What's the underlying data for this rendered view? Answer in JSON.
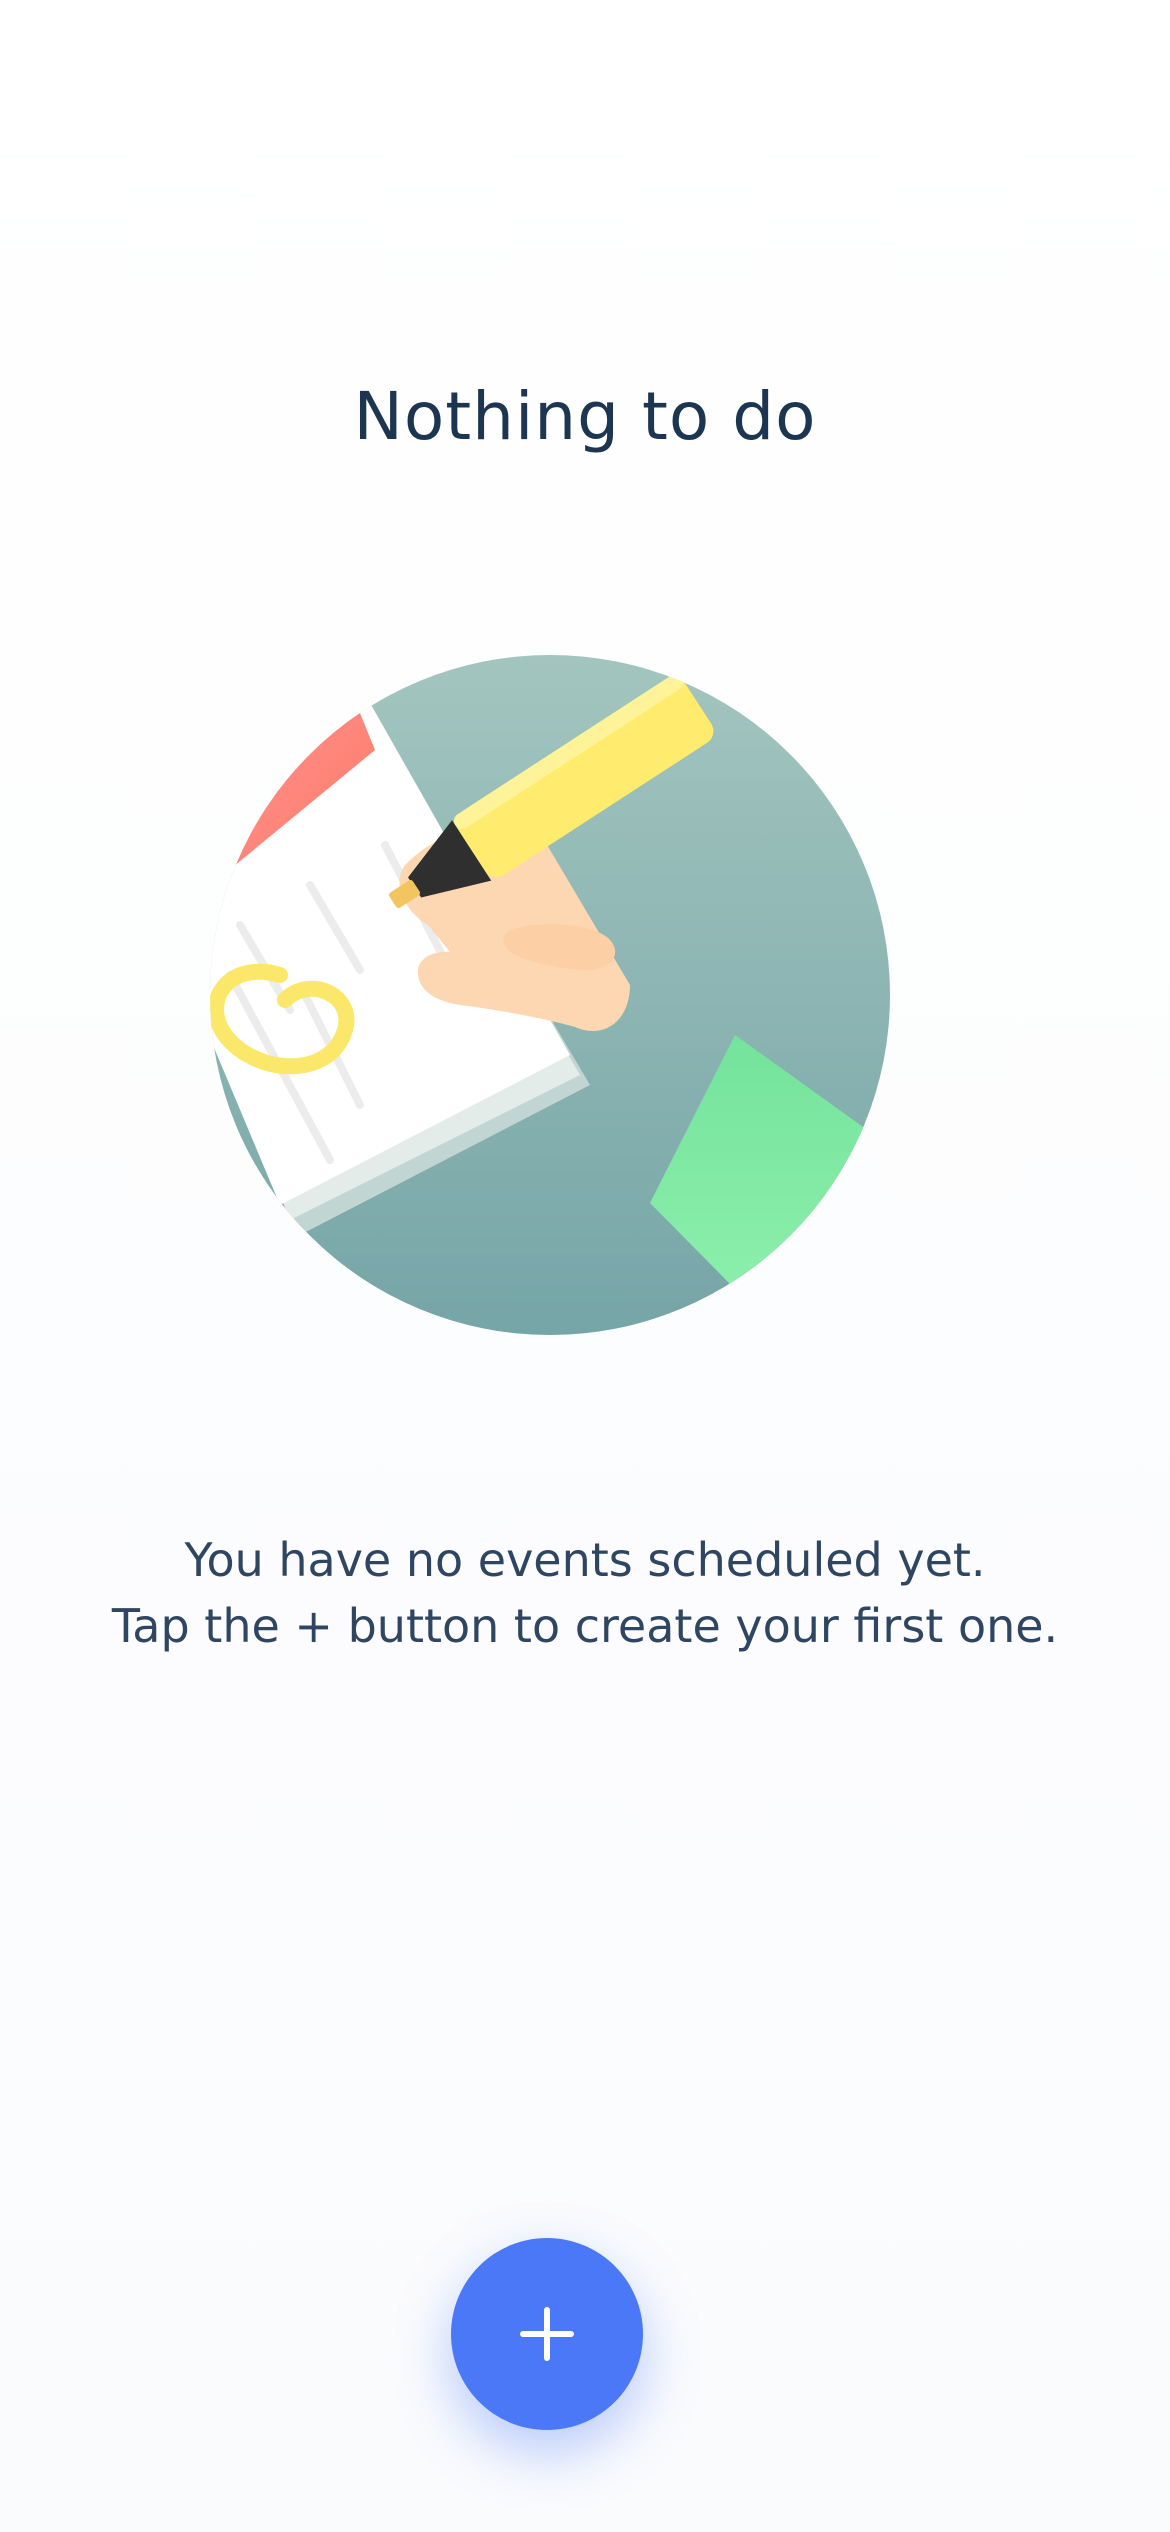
{
  "empty_state": {
    "title": "Nothing to do",
    "message_line_1": "You have no events scheduled yet.",
    "message_line_2": "Tap the + button to create your first one.",
    "illustration_icon": "hand-with-highlighter-on-notepad"
  },
  "fab": {
    "icon": "plus-icon",
    "accent_color": "#4a78f7"
  },
  "colors": {
    "title_text": "#1c3551",
    "body_text": "#2e4662",
    "illustration_background": "#9cc1bb",
    "notepad_header": "#ff8b82",
    "highlighter": "#ffec6e",
    "sleeve": "#86efa7"
  }
}
